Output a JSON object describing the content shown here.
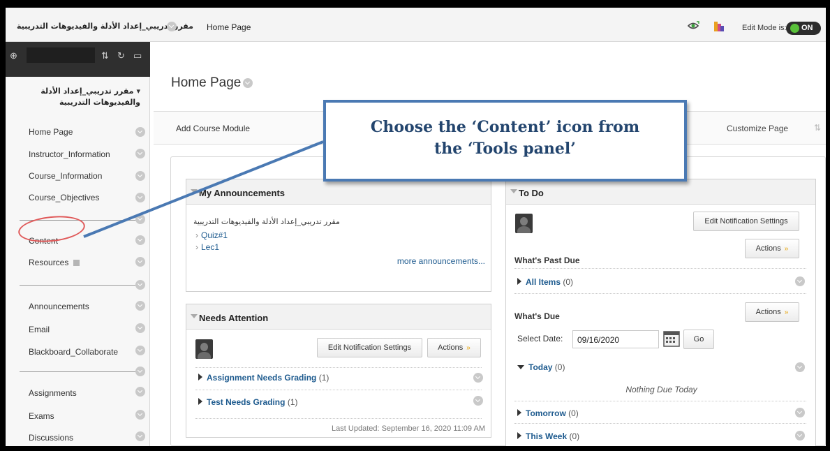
{
  "topbar": {
    "course_name": "مقرر تدريبي_إعداد الأدلة والفيديوهات التدريبية",
    "breadcrumb": "Home Page",
    "edit_mode_label": "Edit Mode is:",
    "edit_mode_value": "ON"
  },
  "sidebar": {
    "course_name": "مقرر تدريبي_إعداد الأدلة والفيديوهات التدريبية",
    "items": [
      {
        "label": "Home Page"
      },
      {
        "label": "Instructor_Information"
      },
      {
        "label": "Course_Information"
      },
      {
        "label": "Course_Objectives"
      },
      {
        "label": "Content"
      },
      {
        "label": "Resources"
      },
      {
        "label": "Announcements"
      },
      {
        "label": "Email"
      },
      {
        "label": "Blackboard_Collaborate"
      },
      {
        "label": "Assignments"
      },
      {
        "label": "Exams"
      },
      {
        "label": "Discussions"
      }
    ]
  },
  "main": {
    "title": "Home Page",
    "add_module": "Add Course Module",
    "customize": "Customize Page"
  },
  "announcements": {
    "title": "My Announcements",
    "course_name": "مقرر تدريبي_إعداد الأدلة والفيديوهات التدريبية",
    "items": [
      "Quiz#1",
      "Lec1"
    ],
    "more": "more announcements..."
  },
  "needs_attention": {
    "title": "Needs Attention",
    "edit_notif": "Edit Notification Settings",
    "actions": "Actions",
    "rows": [
      {
        "label": "Assignment Needs Grading",
        "count": "(1)"
      },
      {
        "label": "Test Needs Grading",
        "count": "(1)"
      }
    ],
    "last_updated": "Last Updated: September 16, 2020 11:09 AM"
  },
  "todo": {
    "title": "To Do",
    "edit_notif": "Edit Notification Settings",
    "past_due_title": "What's Past Due",
    "actions": "Actions",
    "all_items": "All Items",
    "all_items_count": "(0)",
    "due_title": "What's Due",
    "select_date_label": "Select Date:",
    "date_value": "09/16/2020",
    "go": "Go",
    "today": "Today",
    "today_count": "(0)",
    "nothing_due": "Nothing Due Today",
    "tomorrow": "Tomorrow",
    "tomorrow_count": "(0)",
    "this_week": "This Week",
    "this_week_count": "(0)"
  },
  "callout": {
    "line1": "Choose the ‘Content’ icon from",
    "line2": "the ‘Tools panel’"
  },
  "colors": {
    "callout_border": "#4a79b3",
    "callout_text": "#23456e",
    "highlight_circle": "#e05a5a",
    "link": "#1d5a8e",
    "toggle_on": "#59c13a"
  }
}
